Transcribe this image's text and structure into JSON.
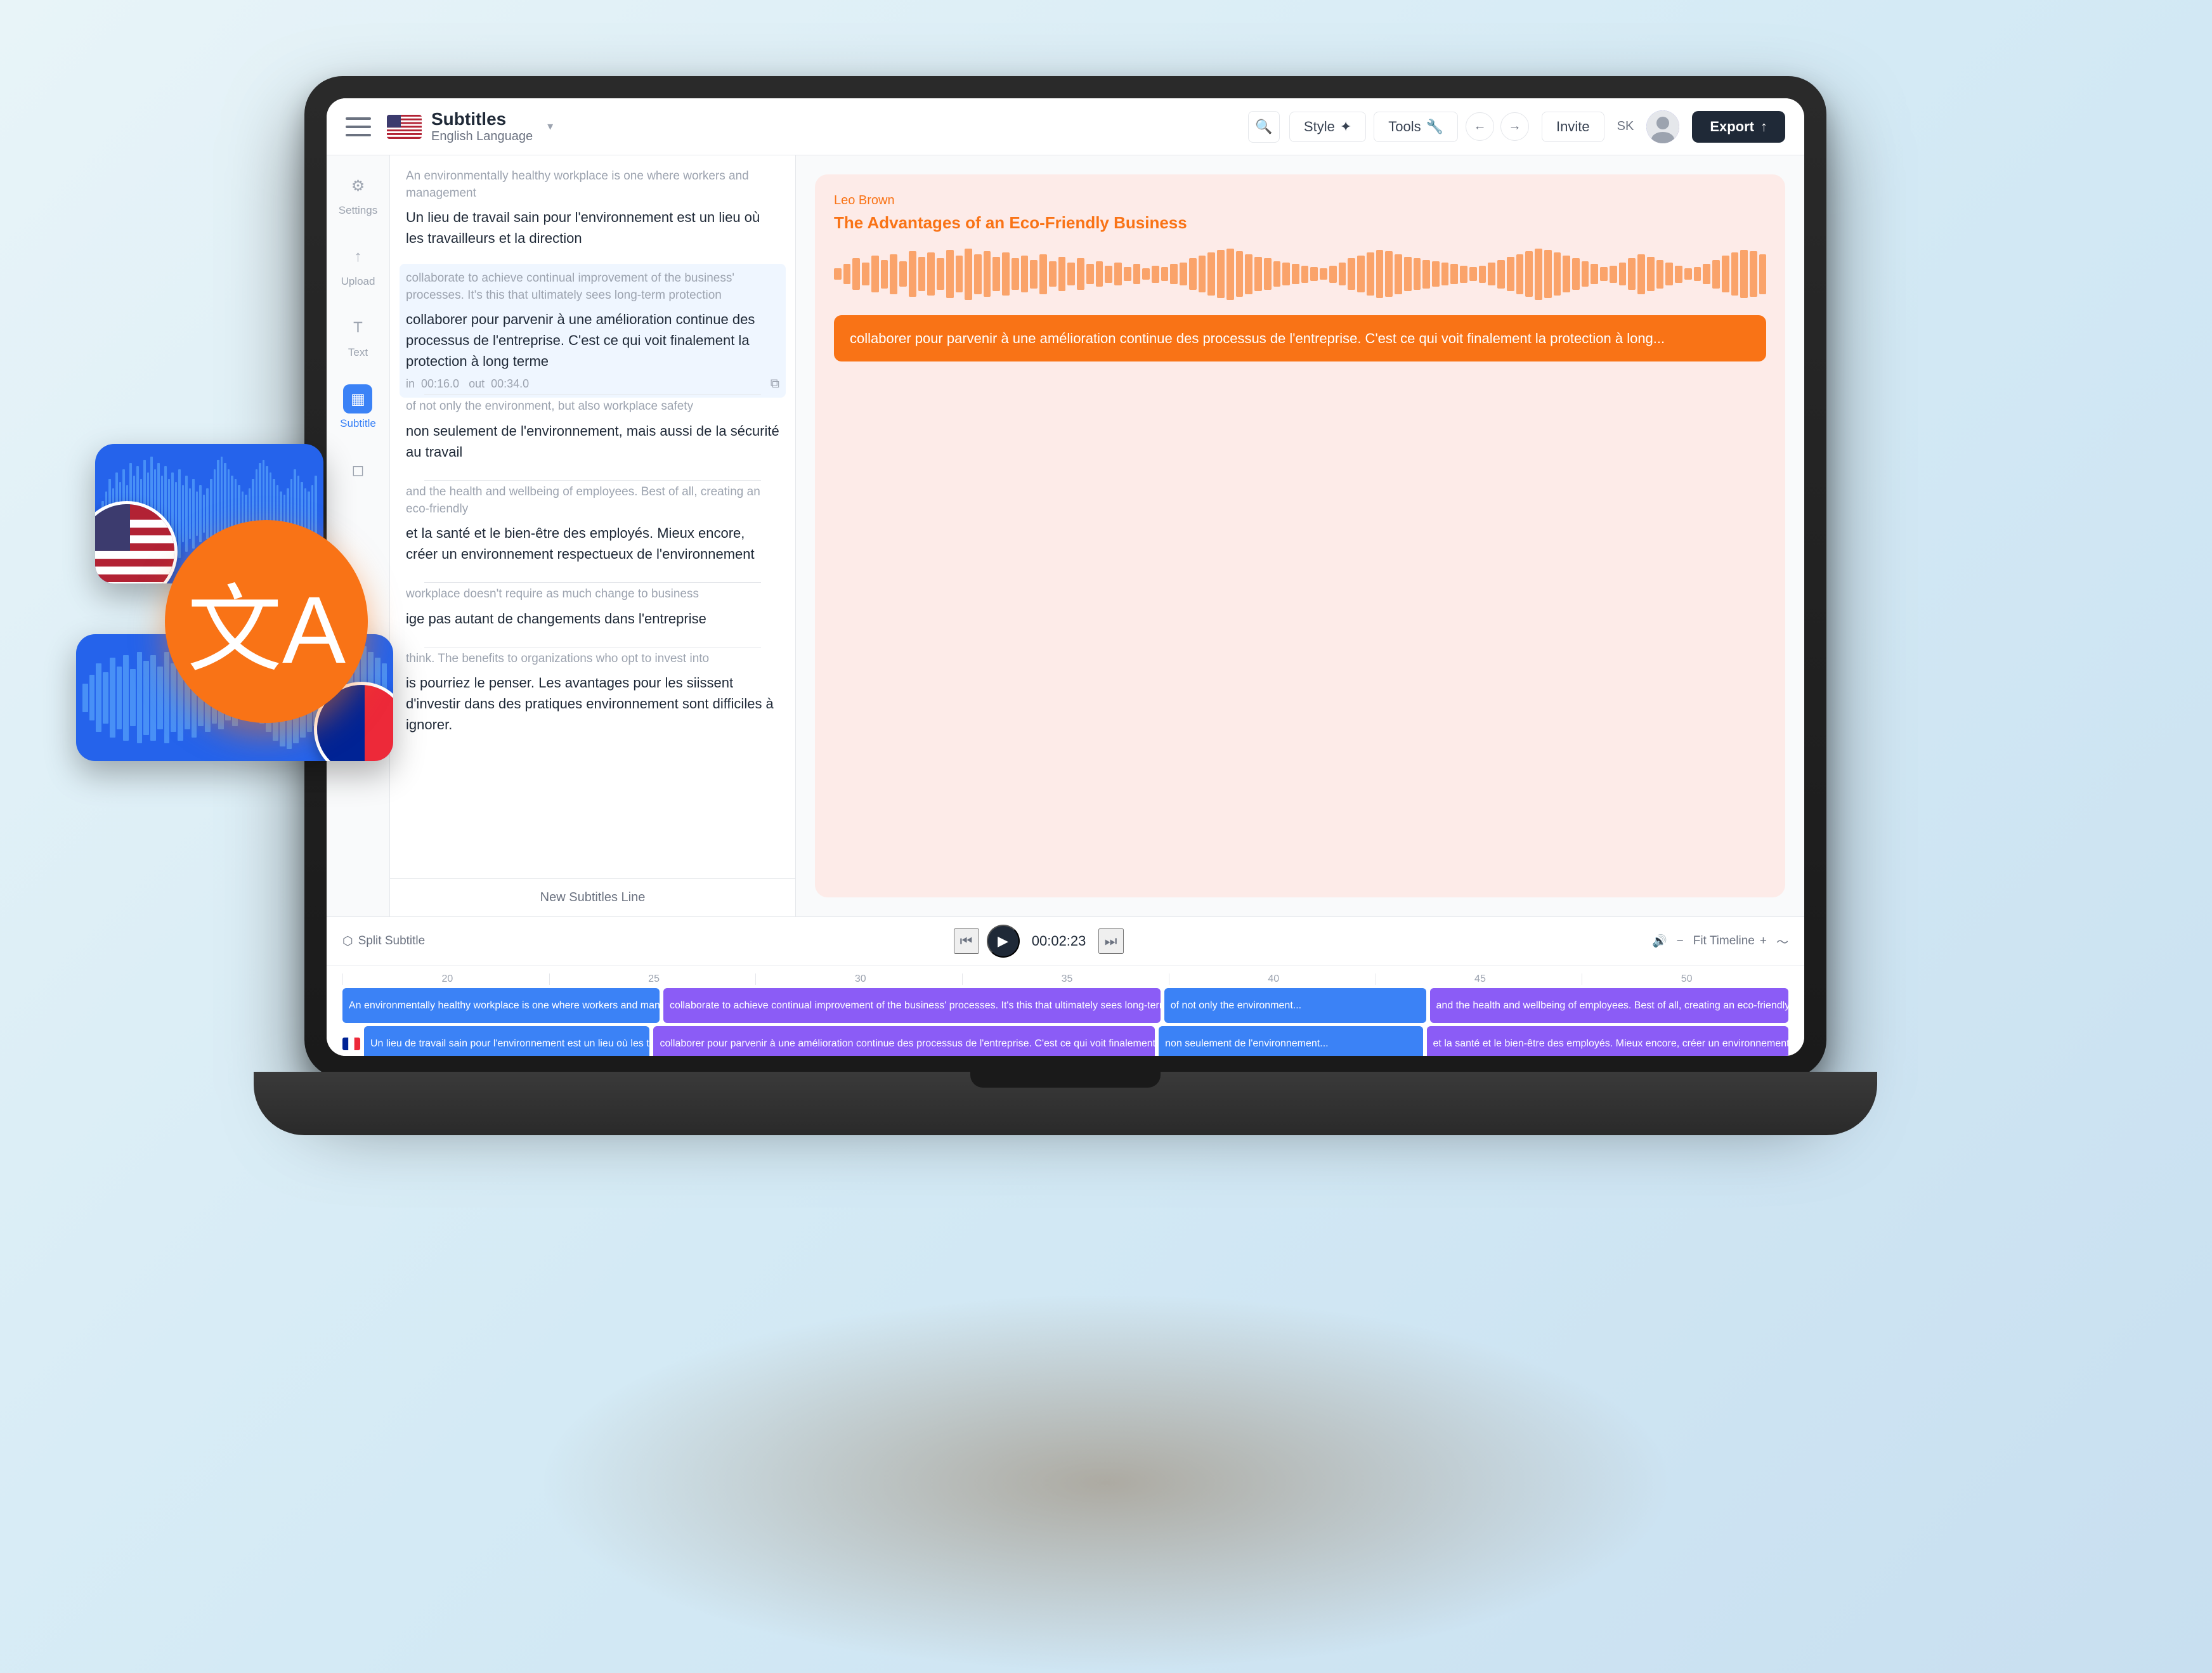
{
  "app": {
    "title": "Subtitles",
    "language": "English Language",
    "nav": {
      "back_label": "←",
      "forward_label": "→",
      "invite_label": "Invite",
      "user_initials": "SK",
      "export_label": "Export"
    },
    "toolbar": {
      "style_label": "Style",
      "tools_label": "Tools"
    }
  },
  "sidebar": {
    "items": [
      {
        "label": "Settings",
        "icon": "⚙",
        "active": false
      },
      {
        "label": "Upload",
        "icon": "↑",
        "active": false
      },
      {
        "label": "Text",
        "icon": "T",
        "active": false
      },
      {
        "label": "Subtitle",
        "icon": "▦",
        "active": true
      },
      {
        "label": "",
        "icon": "◻",
        "active": false
      }
    ]
  },
  "subtitles": {
    "entries": [
      {
        "original": "An environmentally healthy workplace is one where workers and management",
        "translation": "Un lieu de travail sain pour l'environnement est un lieu où les travailleurs et la direction"
      },
      {
        "original": "collaborate to achieve continual improvement of the business' processes. It's this that ultimately sees long-term protection",
        "translation": "collaborer pour parvenir à une amélioration continue des processus de l'entreprise. C'est ce qui voit finalement la protection à long terme",
        "time_in": "00:16.0",
        "time_out": "00:34.0",
        "highlighted": true
      },
      {
        "original": "of not only the environment, but also workplace safety",
        "translation": "non seulement de l'environnement, mais aussi de la sécurité au travail"
      },
      {
        "original": "and the health and wellbeing of employees. Best of all, creating an eco-friendly",
        "translation": "et la santé et le bien-être des employés. Mieux encore, créer un environnement respectueux de l'environnement"
      },
      {
        "original": "workplace doesn't require as much change to business",
        "translation": "ige pas autant de changements dans l'entreprise"
      },
      {
        "original": "think. The benefits to organizations who opt to invest into",
        "translation": "is pourriez le penser. Les avantages pour les siissent d'investir dans des pratiques \renvironnement sont difficiles à ignorer."
      }
    ],
    "add_line_label": "New Subtitles Line"
  },
  "preview": {
    "author": "Leo Brown",
    "title": "The Advantages of an Eco-Friendly Business",
    "highlighted_text": "collaborer pour parvenir à une amélioration continue des processus de l'entreprise. C'est ce qui voit finalement la protection à long..."
  },
  "timeline": {
    "split_subtitle_label": "Split Subtitle",
    "time_display": "00:02:23",
    "fit_timeline_label": "Fit Timeline",
    "ruler_ticks": [
      "20",
      "25",
      "30",
      "35",
      "40",
      "45",
      "50"
    ],
    "subtitle_blocks_en": [
      {
        "text": "An environmentally healthy workplace is one where workers and management",
        "color": "blue"
      },
      {
        "text": "collaborate to achieve continual improvement of the business' processes. It's this that ultimately sees long-term protection",
        "color": "purple"
      },
      {
        "text": "of not only the environment...",
        "color": "blue"
      },
      {
        "text": "and the health and wellbeing of employees. Best of all, creating an eco-friendly",
        "color": "purple"
      }
    ],
    "subtitle_blocks_fr": [
      {
        "text": "Un lieu de travail sain pour l'environnement est un lieu où les travailleurs et la direction",
        "color": "blue"
      },
      {
        "text": "collaborer pour parvenir à une amélioration continue des processus de l'entreprise. C'est ce qui voit finalement la protection à long...",
        "color": "purple"
      },
      {
        "text": "non seulement de l'environnement...",
        "color": "blue"
      },
      {
        "text": "et la santé et le bien-être des employés. Mieux encore, créer un environnement respectueux de...",
        "color": "purple"
      }
    ]
  },
  "floating": {
    "translate_icon": "文",
    "us_flag_label": "US Flag",
    "fr_flag_label": "French Flag"
  }
}
